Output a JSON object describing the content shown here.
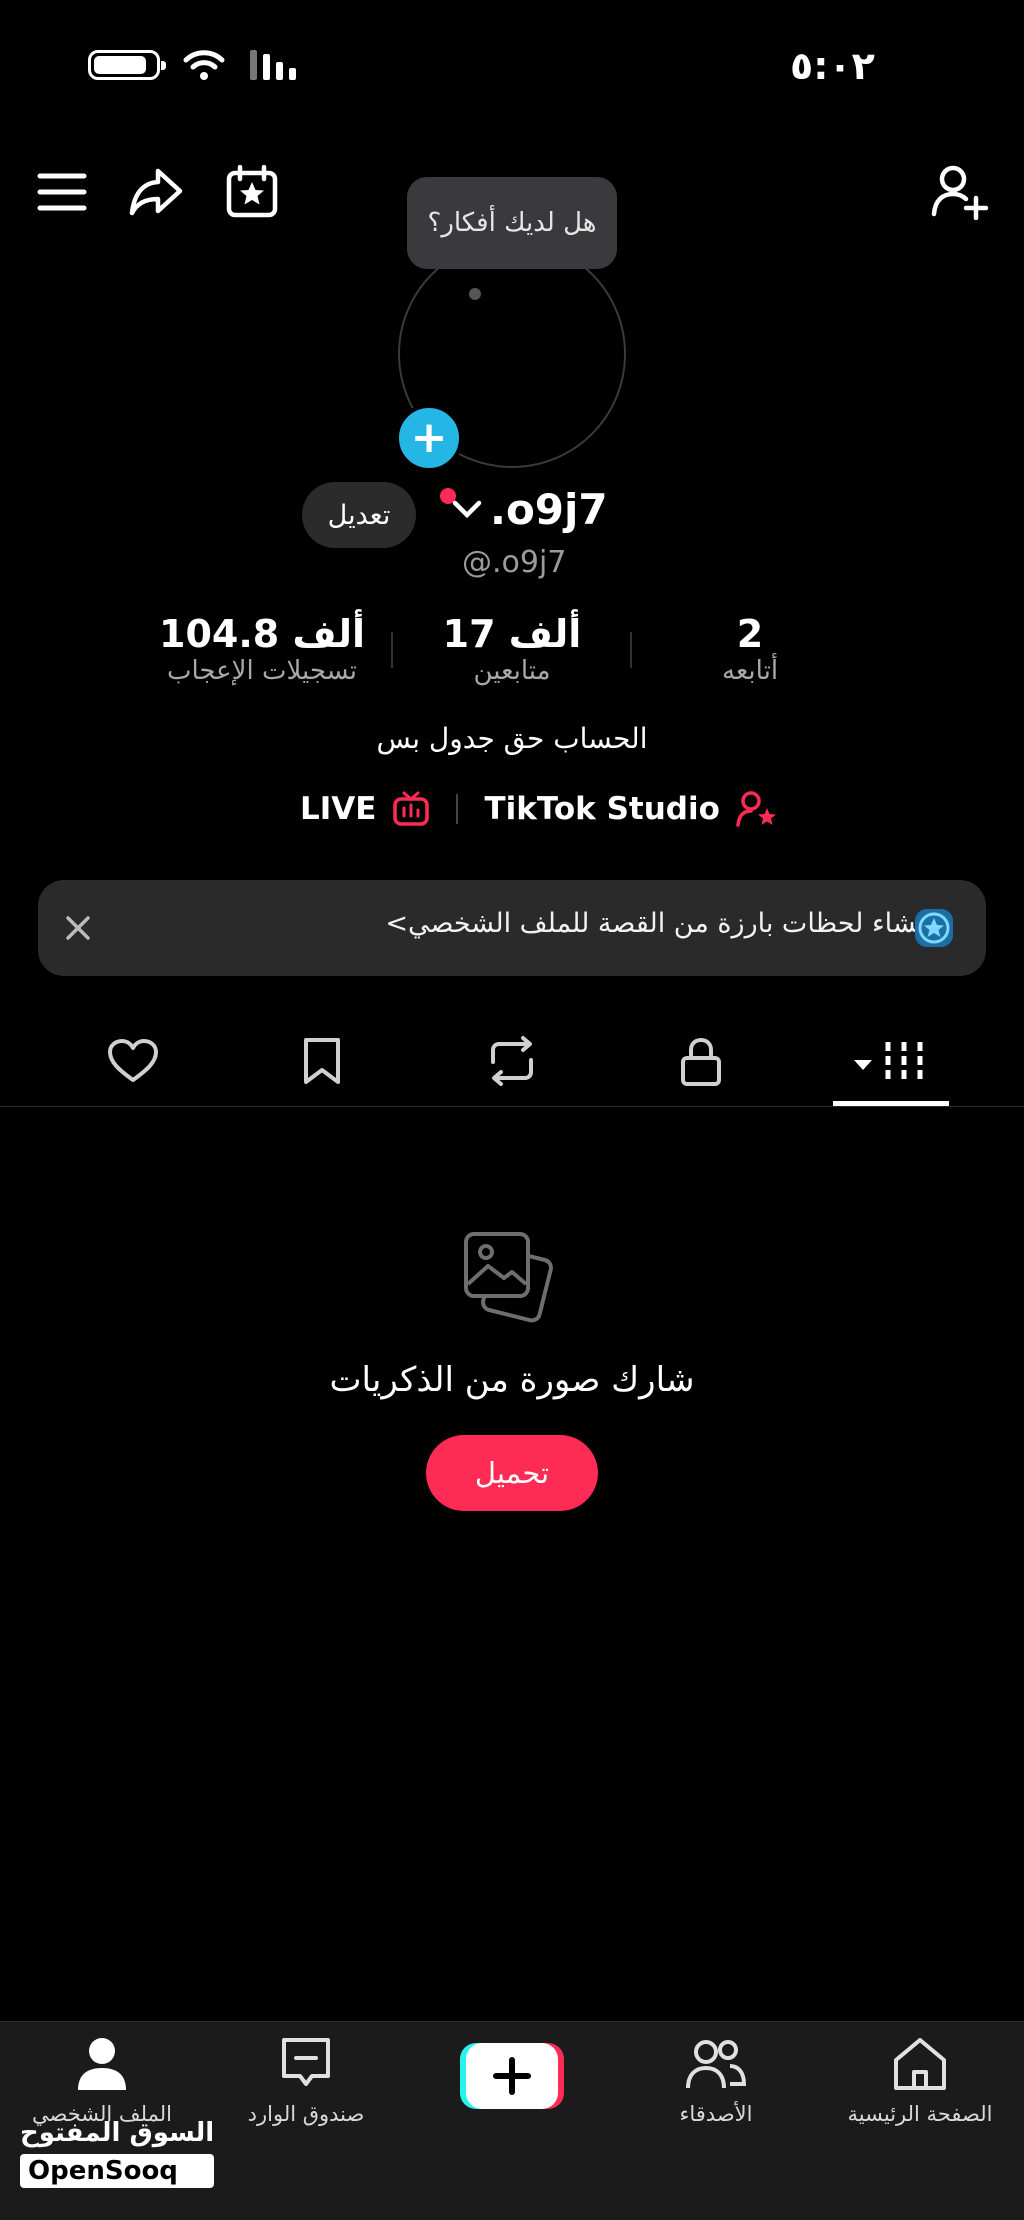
{
  "status_bar": {
    "time": "٥:٠٢",
    "battery_level": 0.8
  },
  "topbar": {
    "icons": [
      "menu-icon",
      "share-icon",
      "calendar-star-icon",
      "add-user-icon"
    ]
  },
  "profile": {
    "tooltip": "هل لديك أفكار؟",
    "edit_label": "تعديل",
    "username": ".o9j7",
    "handle": "@.o9j7",
    "stats": [
      {
        "value": "2",
        "label": "أتابعه"
      },
      {
        "value": "17 ألف",
        "label": "متابعين"
      },
      {
        "value": "104.8 ألف",
        "label": "تسجيلات الإعجاب"
      }
    ],
    "bio": "الحساب حق جدول بس",
    "links": {
      "studio": "TikTok Studio",
      "live": "LIVE"
    }
  },
  "banner": {
    "text": "إنشاء لحظات بارزة من القصة للملف الشخصي",
    "chevron": "<"
  },
  "tabs": [
    "grid-icon",
    "lock-icon",
    "repost-icon",
    "bookmark-icon",
    "heart-icon"
  ],
  "empty_state": {
    "title": "شارك صورة من الذكريات",
    "upload_label": "تحميل"
  },
  "bottom_nav": {
    "home": "الصفحة الرئيسية",
    "friends": "الأصدقاء",
    "inbox": "صندوق الوارد",
    "profile": "الملف الشخصي"
  },
  "watermark": {
    "arabic": "السوق المفتوح",
    "latin": "OpenSooq"
  },
  "colors": {
    "accent": "#fe2c55",
    "badge": "#24b7e6",
    "background": "#000000"
  }
}
